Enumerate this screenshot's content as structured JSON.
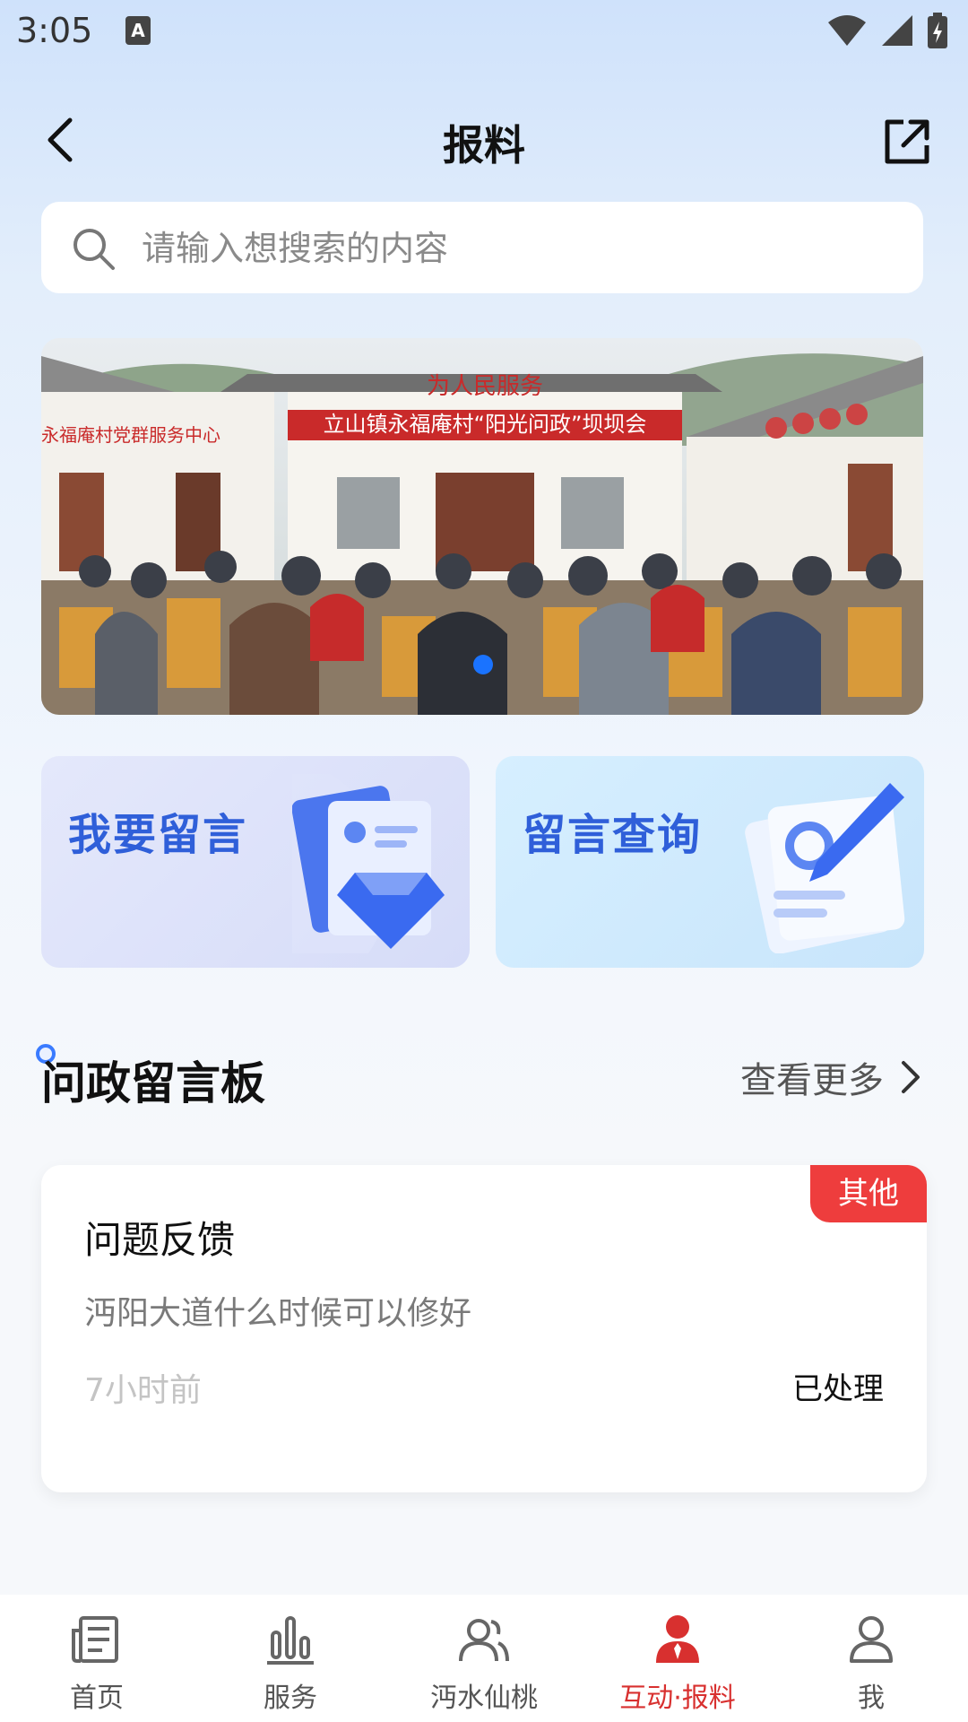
{
  "status_bar": {
    "time": "3:05",
    "notif_icon_letter": "A"
  },
  "navbar": {
    "title": "报料",
    "back_icon": "chevron-left-icon",
    "share_icon": "external-link-icon"
  },
  "search": {
    "placeholder": "请输入想搜索的内容",
    "value": ""
  },
  "banner": {
    "sign_main": "立山镇永福庵村“阳光问政”坝坝会",
    "sign_top": "为人民服务",
    "sign_left": "永福庵村党群服务中心",
    "active_slide": 1,
    "slide_count": 1
  },
  "action_cards": [
    {
      "label": "我要留言",
      "icon": "document-diamond-icon"
    },
    {
      "label": "留言查询",
      "icon": "document-pen-icon"
    }
  ],
  "board": {
    "title": "问政留言板",
    "more_label": "查看更多",
    "items": [
      {
        "badge": "其他",
        "title": "问题反馈",
        "content": "沔阳大道什么时候可以修好",
        "time": "7小时前",
        "status": "已处理"
      }
    ]
  },
  "tabbar": {
    "active_index": 3,
    "items": [
      {
        "label": "首页",
        "icon": "newspaper-icon"
      },
      {
        "label": "服务",
        "icon": "bar-chart-icon"
      },
      {
        "label": "沔水仙桃",
        "icon": "users-icon"
      },
      {
        "label": "互动·报料",
        "icon": "person-tie-icon"
      },
      {
        "label": "我",
        "icon": "user-icon"
      }
    ]
  },
  "colors": {
    "accent_blue": "#2f5fd9",
    "badge_red": "#ee3d3d",
    "active_tab": "#d8302f"
  }
}
